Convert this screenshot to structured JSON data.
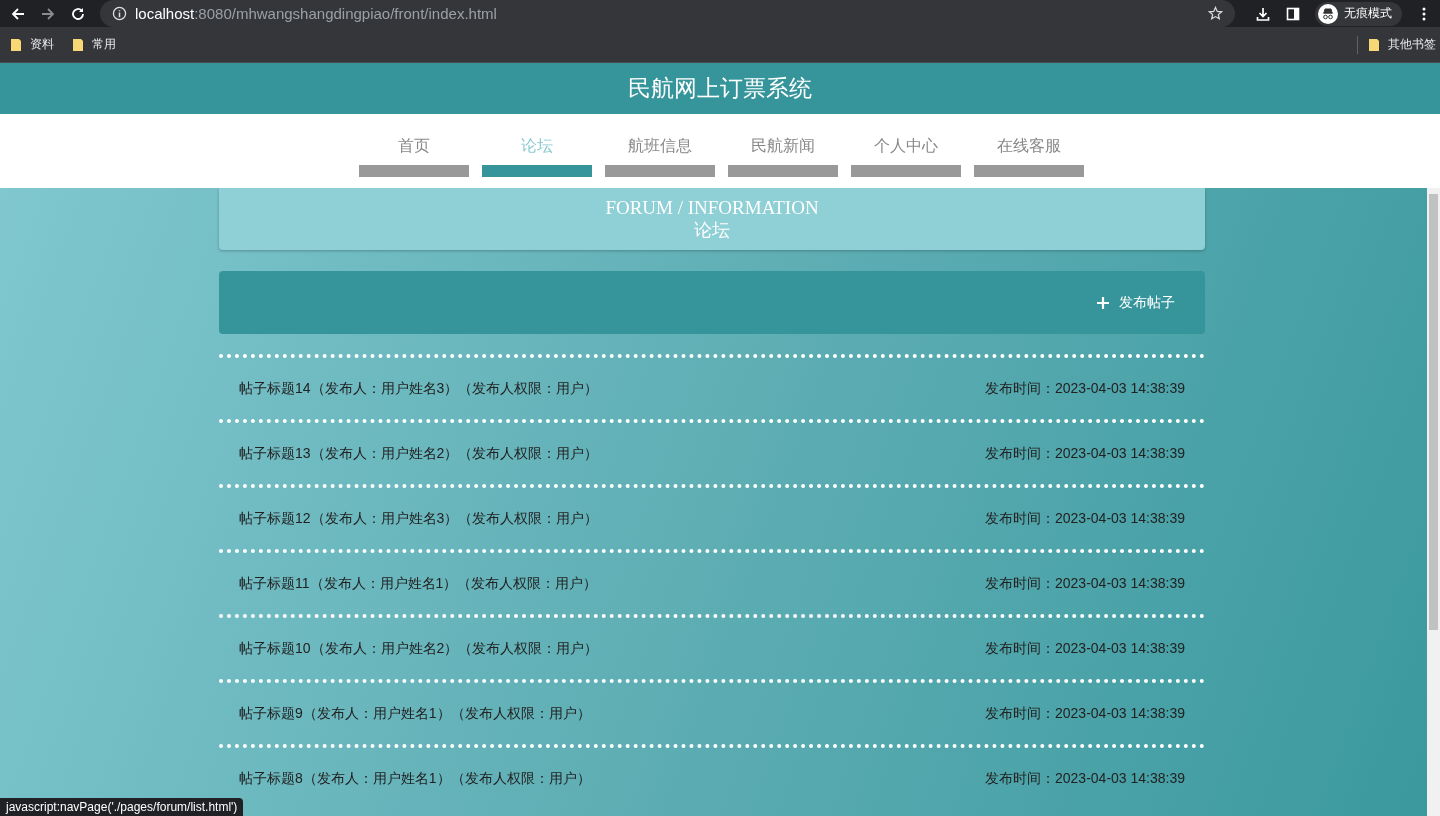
{
  "browser": {
    "url_host": "localhost",
    "url_rest": ":8080/mhwangshangdingpiao/front/index.html",
    "profile": "无痕模式",
    "bookmarks": [
      "资料",
      "常用"
    ],
    "other_bookmarks": "其他书签"
  },
  "site_title": "民航网上订票系统",
  "nav": [
    {
      "label": "首页",
      "selected": false
    },
    {
      "label": "论坛",
      "selected": true
    },
    {
      "label": "航班信息",
      "selected": false
    },
    {
      "label": "民航新闻",
      "selected": false
    },
    {
      "label": "个人中心",
      "selected": false
    },
    {
      "label": "在线客服",
      "selected": false
    }
  ],
  "section": {
    "title_en": "FORUM / INFORMATION",
    "title_cn": "论坛"
  },
  "publish_button": "发布帖子",
  "posts": [
    {
      "title": "帖子标题14（发布人：用户姓名3）（发布人权限：用户）",
      "time": "发布时间：2023-04-03 14:38:39"
    },
    {
      "title": "帖子标题13（发布人：用户姓名2）（发布人权限：用户）",
      "time": "发布时间：2023-04-03 14:38:39"
    },
    {
      "title": "帖子标题12（发布人：用户姓名3）（发布人权限：用户）",
      "time": "发布时间：2023-04-03 14:38:39"
    },
    {
      "title": "帖子标题11（发布人：用户姓名1）（发布人权限：用户）",
      "time": "发布时间：2023-04-03 14:38:39"
    },
    {
      "title": "帖子标题10（发布人：用户姓名2）（发布人权限：用户）",
      "time": "发布时间：2023-04-03 14:38:39"
    },
    {
      "title": "帖子标题9（发布人：用户姓名1）（发布人权限：用户）",
      "time": "发布时间：2023-04-03 14:38:39"
    },
    {
      "title": "帖子标题8（发布人：用户姓名1）（发布人权限：用户）",
      "time": "发布时间：2023-04-03 14:38:39"
    }
  ],
  "status_bar": "javascript:navPage('./pages/forum/list.html')"
}
